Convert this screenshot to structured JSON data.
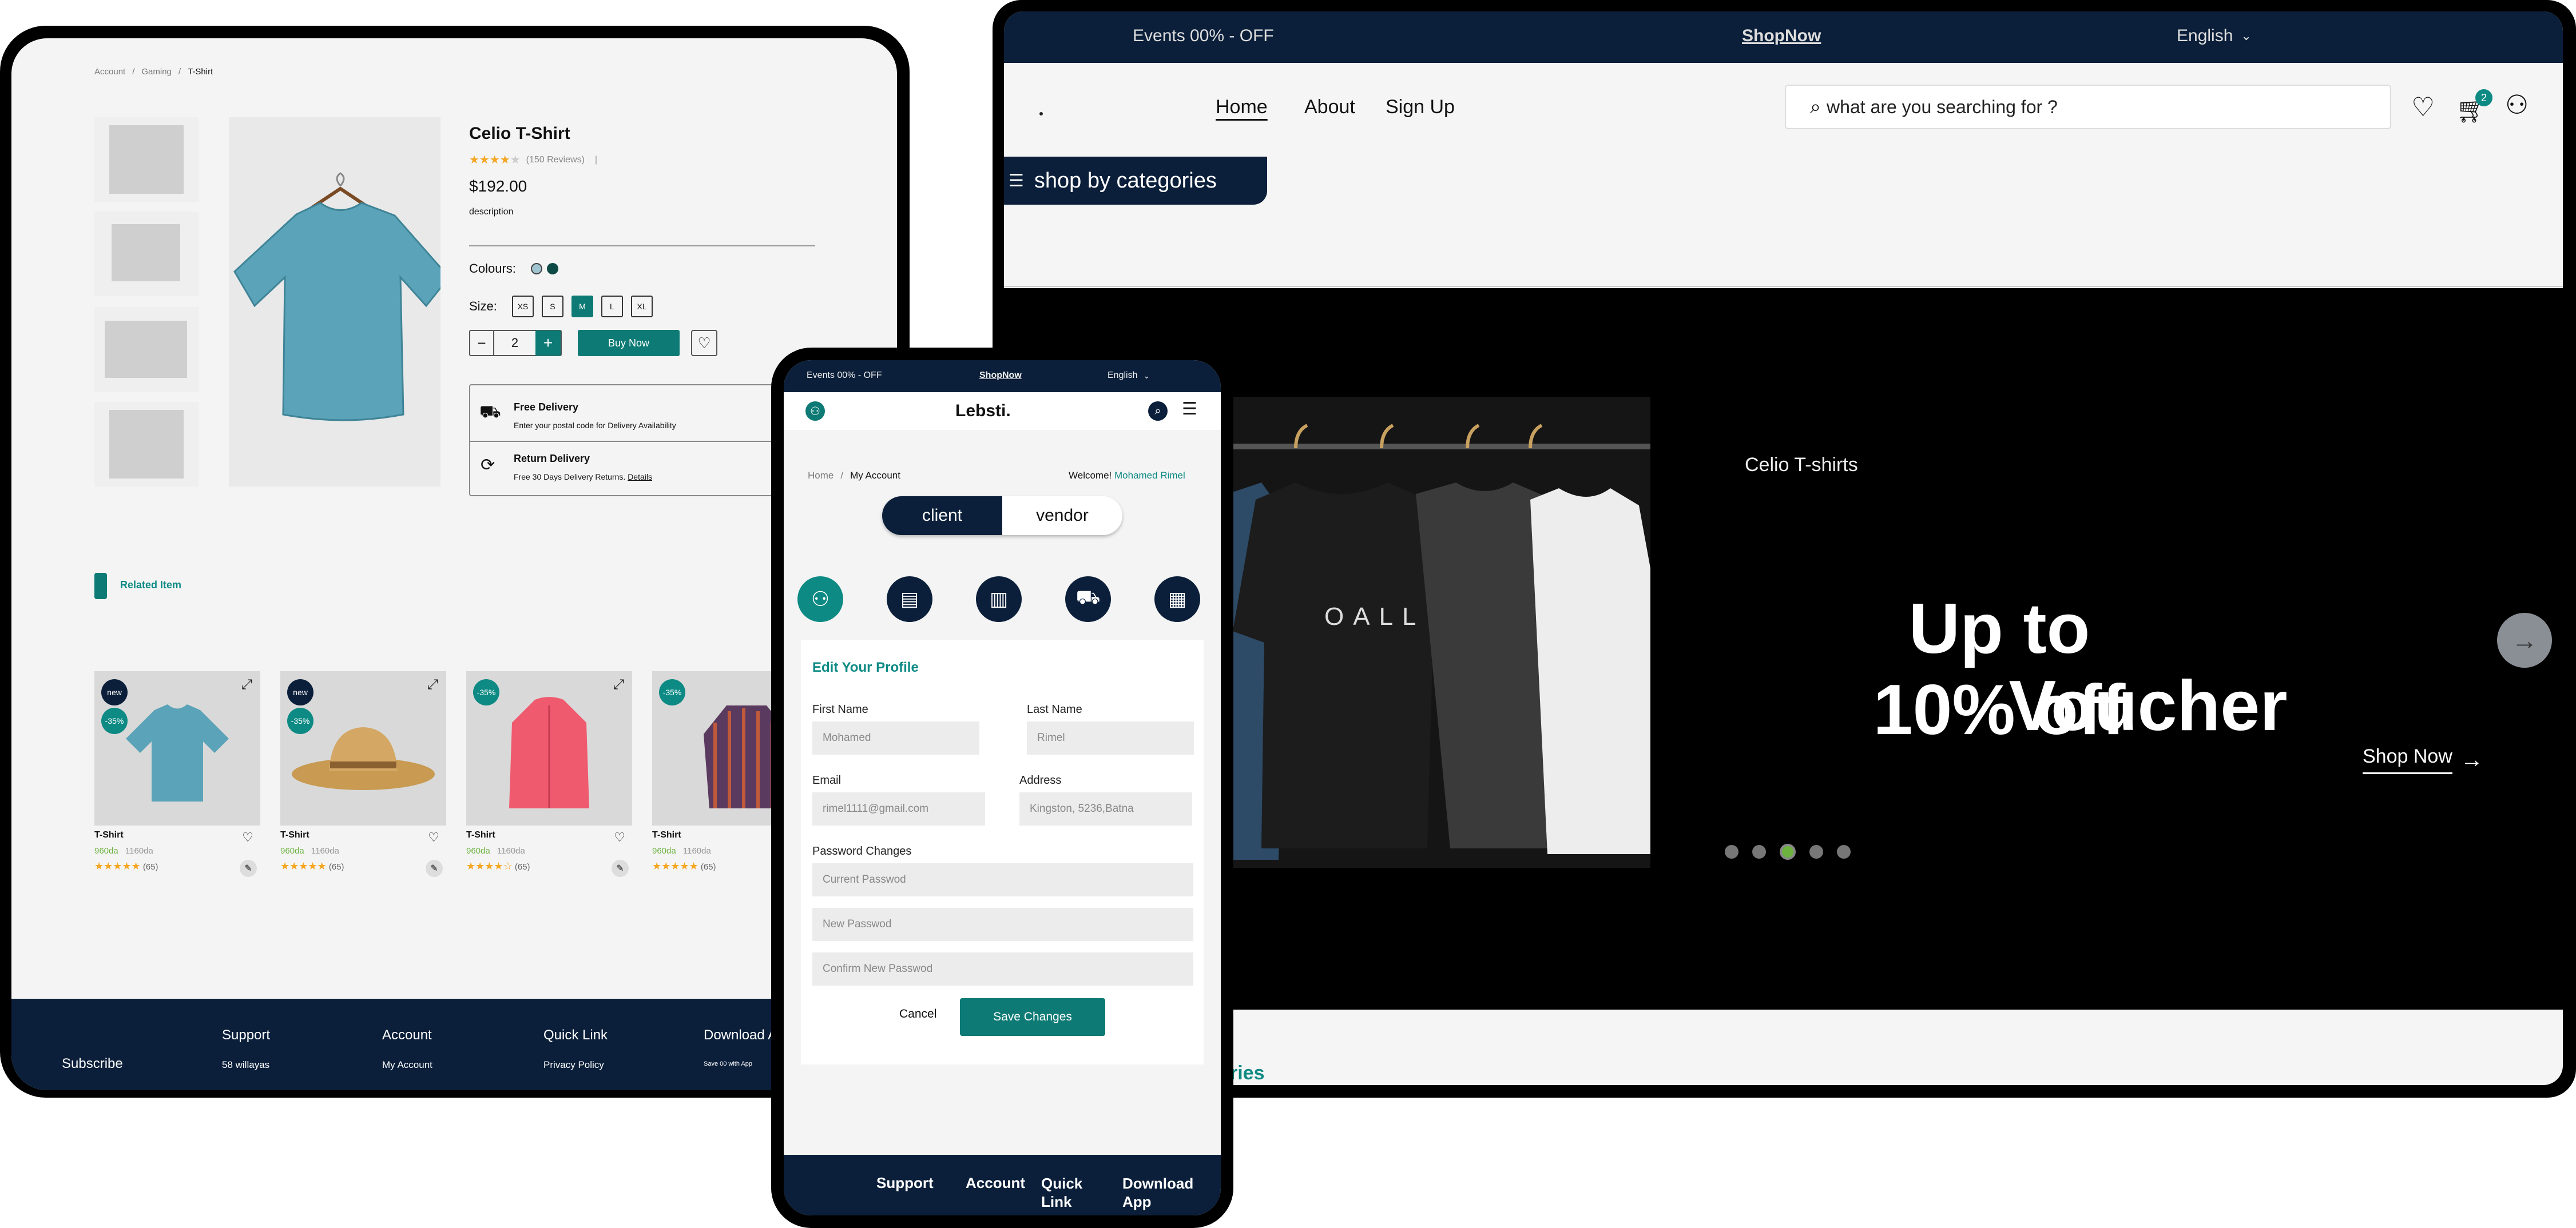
{
  "desktop": {
    "breadcrumb": [
      "Account",
      "Gaming",
      "T-Shirt"
    ],
    "product": {
      "title": "Celio T-Shirt",
      "reviews": "(150 Reviews)",
      "price": "$192.00",
      "description": "description",
      "colours_label": "Colours:",
      "size_label": "Size:",
      "sizes": [
        "XS",
        "S",
        "M",
        "L",
        "XL"
      ],
      "selected_size": "M",
      "quantity": "2",
      "buy_label": "Buy Now",
      "rating": 4
    },
    "delivery": {
      "free_title": "Free Delivery",
      "free_text": "Enter your postal code for Delivery Availability",
      "return_title": "Return Delivery",
      "return_text": "Free 30 Days Delivery Returns.",
      "return_link": "Details"
    },
    "related_title": "Related Item",
    "related": [
      {
        "badge": "new",
        "discount": "-35%",
        "name": "T-Shirt",
        "price": "960da",
        "old_price": "1160da",
        "count": "(65)",
        "rating": 5
      },
      {
        "badge": "new",
        "discount": "-35%",
        "name": "T-Shirt",
        "price": "960da",
        "old_price": "1160da",
        "count": "(65)",
        "rating": 5
      },
      {
        "badge": "",
        "discount": "-35%",
        "name": "T-Shirt",
        "price": "960da",
        "old_price": "1160da",
        "count": "(65)",
        "rating": 4.5
      },
      {
        "badge": "",
        "discount": "-35%",
        "name": "T-Shirt",
        "price": "960da",
        "old_price": "1160da",
        "count": "(65)",
        "rating": 5
      }
    ],
    "footer": {
      "subscribe": "Subscribe",
      "support": "Support",
      "support_item": "58 willayas",
      "account": "Account",
      "account_item": "My Account",
      "quicklink": "Quick Link",
      "quicklink_item": "Privacy Policy",
      "download": "Download App",
      "download_item": "Save 00 with App"
    }
  },
  "tablet": {
    "promo": "Events 00% - OFF",
    "shopnow": "ShopNow",
    "language": "English",
    "nav": [
      "Home",
      "About",
      "Sign Up"
    ],
    "search_placeholder": "what are you searching for ?",
    "cart_count": "2",
    "categories_btn": "shop by categories",
    "hero": {
      "subtitle": "Celio T-shirts",
      "headline_1": "Up to 10% off",
      "headline_2": "Voucher",
      "cta": "Shop Now",
      "shirt_text": "OALL",
      "active_dot": 3
    },
    "bottom_text": "ries"
  },
  "phone": {
    "promo": "Events 00% - OFF",
    "shopnow": "ShopNow",
    "language": "English",
    "brand": "Lebsti.",
    "breadcrumb_home": "Home",
    "breadcrumb_current": "My Account",
    "welcome": "Welcome!",
    "user_name": "Mohamed Rimel",
    "toggle": {
      "client": "client",
      "vendor": "vendor"
    },
    "form": {
      "title": "Edit Your Profile",
      "first_name_label": "First Name",
      "first_name": "Mohamed",
      "last_name_label": "Last Name",
      "last_name": "Rimel",
      "email_label": "Email",
      "email": "rimel1111@gmail.com",
      "address_label": "Address",
      "address": "Kingston, 5236,Batna",
      "password_label": "Password Changes",
      "current_password": "Current Passwod",
      "new_password": "New Passwod",
      "confirm_password": "Confirm New Passwod",
      "cancel": "Cancel",
      "save": "Save Changes"
    },
    "footer": [
      "Support",
      "Account",
      "Quick Link",
      "Download App"
    ]
  },
  "colors": {
    "navy": "#0b1f3a",
    "teal": "#0d7a75",
    "star": "#f5a623",
    "sale": "#6cb33f"
  }
}
